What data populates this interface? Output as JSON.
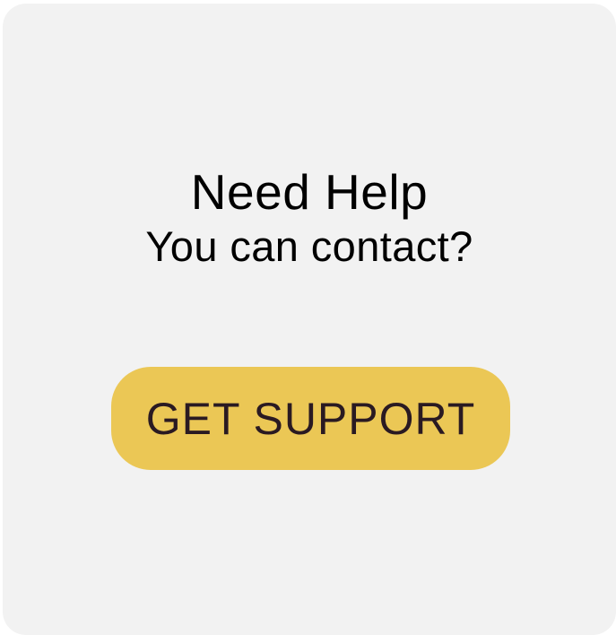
{
  "card": {
    "title": "Need Help",
    "subtitle": "You can contact?",
    "button_label": "GET SUPPORT"
  },
  "colors": {
    "card_background": "#f2f2f2",
    "button_background": "#ebc755",
    "button_text": "#2a1a22",
    "heading_text": "#000000"
  }
}
